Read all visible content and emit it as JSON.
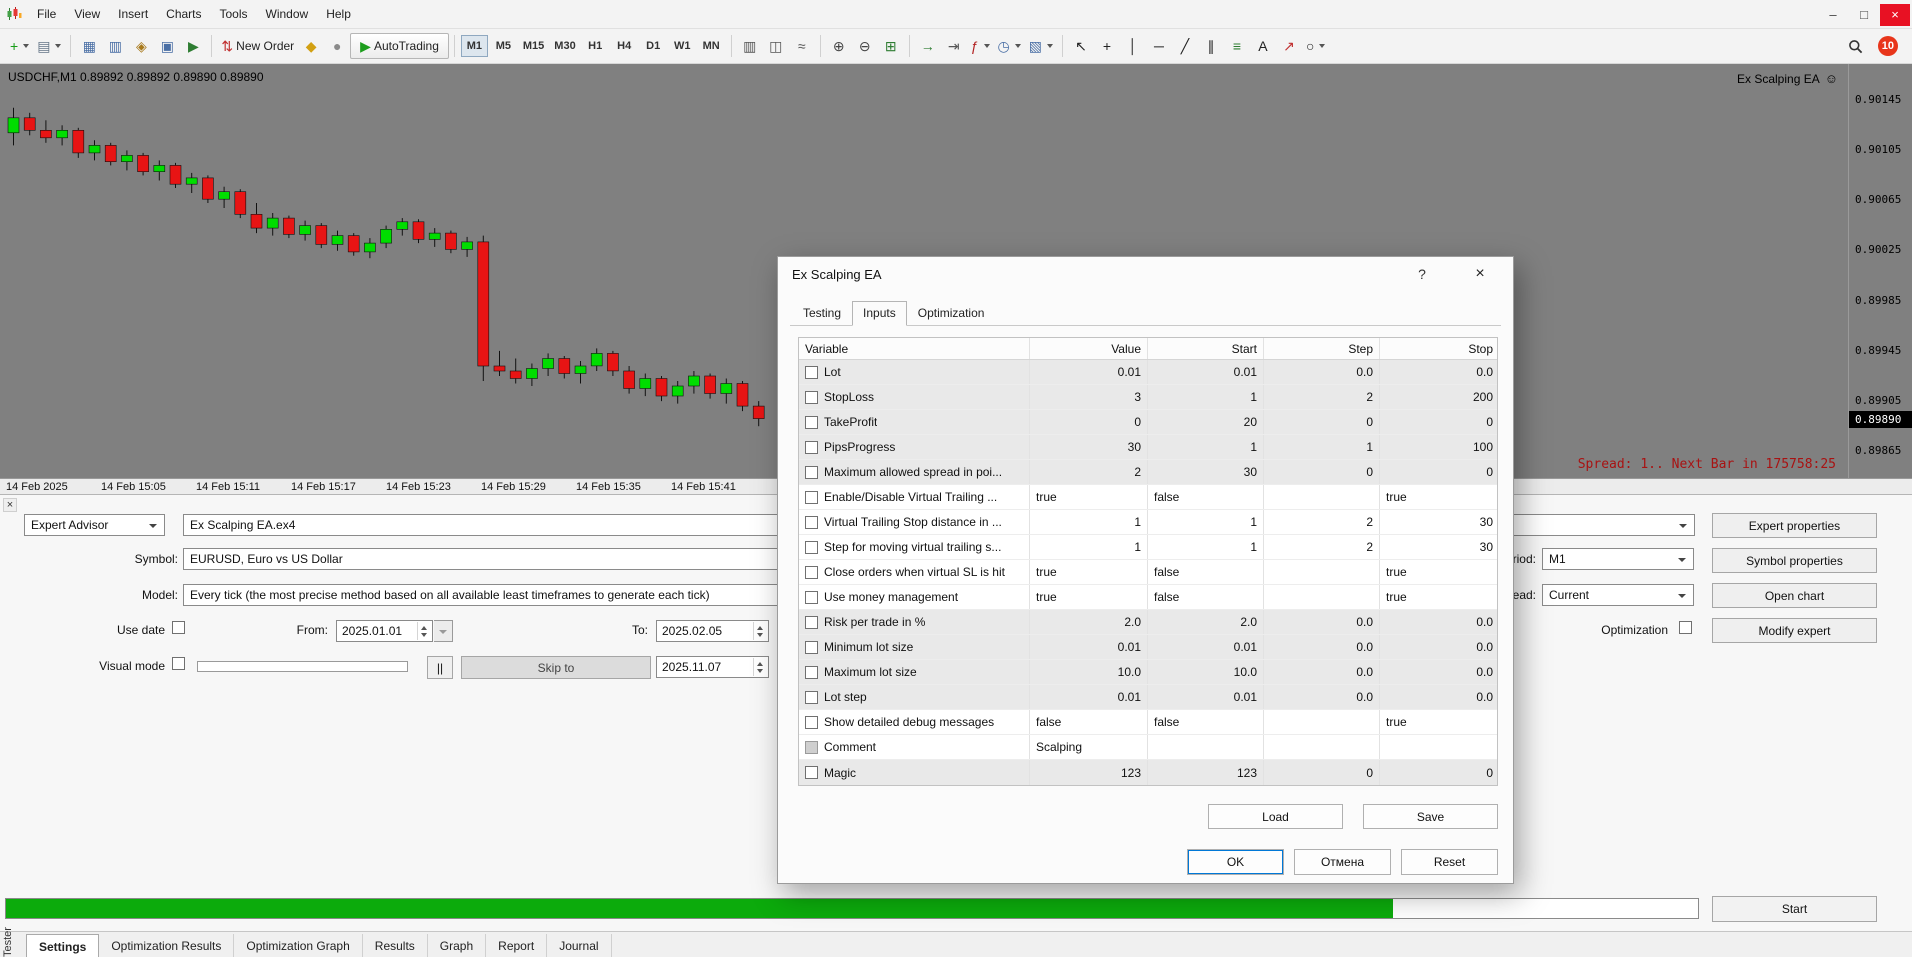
{
  "colors": {
    "accent": "#0078d7",
    "chart_bg": "#808080",
    "up": "#00dd00",
    "down": "#e81414",
    "progress": "#0cab0c",
    "spread_text": "#a81212"
  },
  "menubar": {
    "items": [
      "File",
      "View",
      "Insert",
      "Charts",
      "Tools",
      "Window",
      "Help"
    ],
    "window_controls": [
      {
        "name": "minimize",
        "glyph": "–"
      },
      {
        "name": "maximize",
        "glyph": "□"
      },
      {
        "name": "close",
        "glyph": "×"
      }
    ]
  },
  "toolbar": {
    "notification_count": "10",
    "timeframes": [
      {
        "label": "M1",
        "pressed": true
      },
      {
        "label": "M5"
      },
      {
        "label": "M15"
      },
      {
        "label": "M30"
      },
      {
        "label": "H1"
      },
      {
        "label": "H4"
      },
      {
        "label": "D1"
      },
      {
        "label": "W1"
      },
      {
        "label": "MN"
      }
    ],
    "sections": [
      {
        "type": "icons",
        "items": [
          {
            "icon": "new-chart",
            "dd": true
          },
          {
            "icon": "chart-profiles",
            "dd": true
          }
        ]
      },
      {
        "type": "icons",
        "items": [
          {
            "icon": "market-watch"
          },
          {
            "icon": "data-window"
          },
          {
            "icon": "navigator"
          },
          {
            "icon": "terminal"
          },
          {
            "icon": "strategy-tester"
          }
        ]
      },
      {
        "type": "icons",
        "items": [
          {
            "icon": "new-order",
            "label": "New Order"
          },
          {
            "icon": "metaeditor"
          },
          {
            "icon": "options"
          },
          {
            "icon": "autotrading",
            "label": "AutoTrading",
            "framed": true
          }
        ]
      },
      {
        "type": "timeframes"
      },
      {
        "type": "icons",
        "items": [
          {
            "icon": "charts-bar"
          },
          {
            "icon": "charts-candles"
          },
          {
            "icon": "charts-line"
          }
        ]
      },
      {
        "type": "icons",
        "items": [
          {
            "icon": "zoom-in"
          },
          {
            "icon": "zoom-out"
          },
          {
            "icon": "tile-windows"
          }
        ]
      },
      {
        "type": "icons",
        "items": [
          {
            "icon": "auto-scroll"
          },
          {
            "icon": "chart-shift"
          },
          {
            "icon": "indicators",
            "dd": true
          },
          {
            "icon": "periods",
            "dd": true
          },
          {
            "icon": "templates",
            "dd": true
          }
        ]
      },
      {
        "type": "icons",
        "items": [
          {
            "icon": "cursor"
          },
          {
            "icon": "crosshair"
          },
          {
            "icon": "vertical-line"
          },
          {
            "icon": "horizontal-line"
          },
          {
            "icon": "trendline"
          },
          {
            "icon": "equidistant-channel"
          },
          {
            "icon": "fibonacci"
          },
          {
            "icon": "text"
          },
          {
            "icon": "arrows"
          },
          {
            "icon": "shapes",
            "dd": true
          }
        ]
      }
    ]
  },
  "chart": {
    "ohlc_title": "USDCHF,M1 0.89892 0.89892 0.89890 0.89890",
    "ea_badge": "Ex Scalping EA",
    "ea_smiley": "☺",
    "status_line": "Spread: 1.. Next Bar in 175758:25",
    "current_price": "0.89890",
    "price_axis": [
      "0.90145",
      "0.90105",
      "0.90065",
      "0.90025",
      "0.89985",
      "0.89945",
      "0.89905",
      "0.89865"
    ],
    "time_axis": [
      "14 Feb 2025",
      "14 Feb 15:05",
      "14 Feb 15:11",
      "14 Feb 15:17",
      "14 Feb 15:23",
      "14 Feb 15:29",
      "14 Feb 15:35",
      "14 Feb 15:41"
    ],
    "candles": [
      [
        0.90118,
        0.90138,
        0.90108,
        0.9013
      ],
      [
        0.9013,
        0.90134,
        0.90116,
        0.9012
      ],
      [
        0.9012,
        0.90128,
        0.9011,
        0.90114
      ],
      [
        0.90114,
        0.90124,
        0.90108,
        0.9012
      ],
      [
        0.9012,
        0.90122,
        0.90098,
        0.90102
      ],
      [
        0.90102,
        0.90112,
        0.90096,
        0.90108
      ],
      [
        0.90108,
        0.9011,
        0.90092,
        0.90095
      ],
      [
        0.90095,
        0.90104,
        0.90088,
        0.901
      ],
      [
        0.901,
        0.90102,
        0.90084,
        0.90087
      ],
      [
        0.90087,
        0.90096,
        0.9008,
        0.90092
      ],
      [
        0.90092,
        0.90094,
        0.90074,
        0.90077
      ],
      [
        0.90077,
        0.90086,
        0.9007,
        0.90082
      ],
      [
        0.90082,
        0.90084,
        0.90062,
        0.90065
      ],
      [
        0.90065,
        0.90075,
        0.90058,
        0.90071
      ],
      [
        0.90071,
        0.90073,
        0.9005,
        0.90053
      ],
      [
        0.90053,
        0.90062,
        0.90038,
        0.90042
      ],
      [
        0.90042,
        0.90054,
        0.90036,
        0.9005
      ],
      [
        0.9005,
        0.90052,
        0.90034,
        0.90037
      ],
      [
        0.90037,
        0.90048,
        0.90032,
        0.90044
      ],
      [
        0.90044,
        0.90046,
        0.90026,
        0.90029
      ],
      [
        0.90029,
        0.9004,
        0.90024,
        0.90036
      ],
      [
        0.90036,
        0.90038,
        0.9002,
        0.90023
      ],
      [
        0.90023,
        0.90034,
        0.90018,
        0.9003
      ],
      [
        0.9003,
        0.90044,
        0.90026,
        0.90041
      ],
      [
        0.90041,
        0.9005,
        0.90036,
        0.90047
      ],
      [
        0.90047,
        0.90049,
        0.9003,
        0.90033
      ],
      [
        0.90033,
        0.90042,
        0.90027,
        0.90038
      ],
      [
        0.90038,
        0.9004,
        0.90022,
        0.90025
      ],
      [
        0.90025,
        0.90035,
        0.90019,
        0.90031
      ],
      [
        0.90031,
        0.90036,
        0.8992,
        0.89932
      ],
      [
        0.89932,
        0.89944,
        0.89924,
        0.89928
      ],
      [
        0.89928,
        0.89938,
        0.89918,
        0.89922
      ],
      [
        0.89922,
        0.89934,
        0.89916,
        0.8993
      ],
      [
        0.8993,
        0.89942,
        0.89924,
        0.89938
      ],
      [
        0.89938,
        0.8994,
        0.89922,
        0.89926
      ],
      [
        0.89926,
        0.89936,
        0.89918,
        0.89932
      ],
      [
        0.89932,
        0.89946,
        0.89928,
        0.89942
      ],
      [
        0.89942,
        0.89944,
        0.89924,
        0.89928
      ],
      [
        0.89928,
        0.89932,
        0.8991,
        0.89914
      ],
      [
        0.89914,
        0.89926,
        0.89908,
        0.89922
      ],
      [
        0.89922,
        0.89924,
        0.89904,
        0.89908
      ],
      [
        0.89908,
        0.8992,
        0.89902,
        0.89916
      ],
      [
        0.89916,
        0.89928,
        0.8991,
        0.89924
      ],
      [
        0.89924,
        0.89926,
        0.89906,
        0.8991
      ],
      [
        0.8991,
        0.89922,
        0.89902,
        0.89918
      ],
      [
        0.89918,
        0.8992,
        0.89896,
        0.899
      ],
      [
        0.899,
        0.89904,
        0.89884,
        0.8989
      ]
    ]
  },
  "tester": {
    "panel_label": "Tester",
    "close_glyph": "×",
    "expert_combo": "Expert Advisor",
    "expert_file": "Ex Scalping EA.ex4",
    "symbol_label": "Symbol:",
    "symbol_value": "EURUSD, Euro vs US Dollar",
    "model_label": "Model:",
    "model_value": "Every tick (the most precise method based on all available least timeframes to generate each tick)",
    "use_date_label": "Use date",
    "from_label": "From:",
    "from_value": "2025.01.01",
    "to_label": "To:",
    "to_value": "2025.02.05",
    "visual_mode_label": "Visual mode",
    "pause_label": "||",
    "skip_to_label": "Skip to",
    "skip_to_value": "2025.11.07",
    "period_label": "Period:",
    "period_value": "M1",
    "spread_label": "Spread:",
    "spread_value": "Current",
    "optimization_label": "Optimization",
    "buttons": [
      "Expert properties",
      "Symbol properties",
      "Open chart",
      "Modify expert"
    ],
    "start_label": "Start",
    "progress_percent": 82,
    "tabs": [
      {
        "label": "Settings",
        "active": true
      },
      {
        "label": "Optim­ization Results"
      },
      {
        "label": "Optimization Graph"
      },
      {
        "label": "Results"
      },
      {
        "label": "Graph"
      },
      {
        "label": "Report"
      },
      {
        "label": "Journal"
      }
    ]
  },
  "dialog": {
    "title": "Ex Scalping EA",
    "help_glyph": "?",
    "close_glyph": "×",
    "tabs": [
      {
        "label": "Testing"
      },
      {
        "label": "Inputs",
        "active": true
      },
      {
        "label": "Optimization"
      }
    ],
    "table_headers": [
      "Variable",
      "Value",
      "Start",
      "Step",
      "Stop"
    ],
    "rows": [
      {
        "name": "Lot",
        "value": "0.01",
        "start": "0.01",
        "step": "0.0",
        "stop": "0.0",
        "shaded": true,
        "num": true
      },
      {
        "name": "StopLoss",
        "value": "3",
        "start": "1",
        "step": "2",
        "stop": "200",
        "shaded": true,
        "num": true
      },
      {
        "name": "TakeProfit",
        "value": "0",
        "start": "20",
        "step": "0",
        "stop": "0",
        "shaded": true,
        "num": true
      },
      {
        "name": "PipsProgress",
        "value": "30",
        "start": "1",
        "step": "1",
        "stop": "100",
        "shaded": true,
        "num": true
      },
      {
        "name": "Maximum allowed spread in poi...",
        "value": "2",
        "start": "30",
        "step": "0",
        "stop": "0",
        "shaded": true,
        "num": true
      },
      {
        "name": "Enable/Disable Virtual Trailing ...",
        "value": "true",
        "start": "false",
        "step": "",
        "stop": "true",
        "shaded": false,
        "num": false
      },
      {
        "name": "Virtual Trailing Stop distance in ...",
        "value": "1",
        "start": "1",
        "step": "2",
        "stop": "30",
        "shaded": false,
        "num": true
      },
      {
        "name": "Step for moving virtual trailing s...",
        "value": "1",
        "start": "1",
        "step": "2",
        "stop": "30",
        "shaded": false,
        "num": true
      },
      {
        "name": "Close orders when virtual SL is hit",
        "value": "true",
        "start": "false",
        "step": "",
        "stop": "true",
        "shaded": false,
        "num": false
      },
      {
        "name": "Use money management",
        "value": "true",
        "start": "false",
        "step": "",
        "stop": "true",
        "shaded": false,
        "num": false
      },
      {
        "name": "Risk per trade in %",
        "value": "2.0",
        "start": "2.0",
        "step": "0.0",
        "stop": "0.0",
        "shaded": true,
        "num": true
      },
      {
        "name": "Minimum lot size",
        "value": "0.01",
        "start": "0.01",
        "step": "0.0",
        "stop": "0.0",
        "shaded": true,
        "num": true
      },
      {
        "name": "Maximum lot size",
        "value": "10.0",
        "start": "10.0",
        "step": "0.0",
        "stop": "0.0",
        "shaded": true,
        "num": true
      },
      {
        "name": "Lot step",
        "value": "0.01",
        "start": "0.01",
        "step": "0.0",
        "stop": "0.0",
        "shaded": true,
        "num": true
      },
      {
        "name": "Show detailed debug messages",
        "value": "false",
        "start": "false",
        "step": "",
        "stop": "true",
        "shaded": false,
        "num": false
      },
      {
        "name": "Comment",
        "value": "Scalping",
        "start": "",
        "step": "",
        "stop": "",
        "shaded": false,
        "num": false,
        "cb_disabled": true
      },
      {
        "name": "Magic",
        "value": "123",
        "start": "123",
        "step": "0",
        "stop": "0",
        "shaded": true,
        "num": true
      }
    ],
    "load_label": "Load",
    "save_label": "Save",
    "ok_label": "OK",
    "cancel_label": "Отмена",
    "reset_label": "Reset"
  }
}
